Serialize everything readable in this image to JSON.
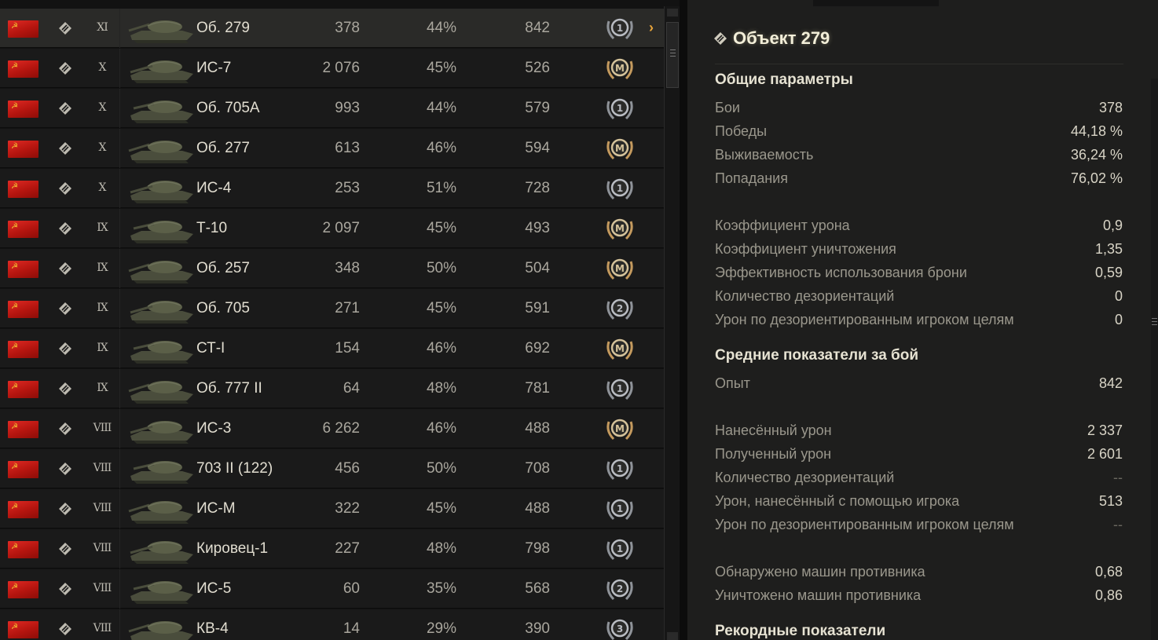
{
  "colors": {
    "accent_arrow": "#e8a43a",
    "flag_red": "#c8201a",
    "selected_row": "#2a2a28"
  },
  "vehicles": [
    {
      "tier": "XI",
      "name": "Об. 279",
      "battles": "378",
      "winrate": "44%",
      "exp": "842",
      "mastery": "1",
      "selected": true
    },
    {
      "tier": "X",
      "name": "ИС-7",
      "battles": "2 076",
      "winrate": "45%",
      "exp": "526",
      "mastery": "M"
    },
    {
      "tier": "X",
      "name": "Об. 705А",
      "battles": "993",
      "winrate": "44%",
      "exp": "579",
      "mastery": "1"
    },
    {
      "tier": "X",
      "name": "Об. 277",
      "battles": "613",
      "winrate": "46%",
      "exp": "594",
      "mastery": "M"
    },
    {
      "tier": "X",
      "name": "ИС-4",
      "battles": "253",
      "winrate": "51%",
      "exp": "728",
      "mastery": "1"
    },
    {
      "tier": "IX",
      "name": "Т-10",
      "battles": "2 097",
      "winrate": "45%",
      "exp": "493",
      "mastery": "M"
    },
    {
      "tier": "IX",
      "name": "Об. 257",
      "battles": "348",
      "winrate": "50%",
      "exp": "504",
      "mastery": "M"
    },
    {
      "tier": "IX",
      "name": "Об. 705",
      "battles": "271",
      "winrate": "45%",
      "exp": "591",
      "mastery": "2"
    },
    {
      "tier": "IX",
      "name": "СТ-I",
      "battles": "154",
      "winrate": "46%",
      "exp": "692",
      "mastery": "M"
    },
    {
      "tier": "IX",
      "name": "Об. 777 II",
      "battles": "64",
      "winrate": "48%",
      "exp": "781",
      "mastery": "1"
    },
    {
      "tier": "VIII",
      "name": "ИС-3",
      "battles": "6 262",
      "winrate": "46%",
      "exp": "488",
      "mastery": "M"
    },
    {
      "tier": "VIII",
      "name": "703 II (122)",
      "battles": "456",
      "winrate": "50%",
      "exp": "708",
      "mastery": "1"
    },
    {
      "tier": "VIII",
      "name": "ИС-М",
      "battles": "322",
      "winrate": "45%",
      "exp": "488",
      "mastery": "1"
    },
    {
      "tier": "VIII",
      "name": "Кировец-1",
      "battles": "227",
      "winrate": "48%",
      "exp": "798",
      "mastery": "1"
    },
    {
      "tier": "VIII",
      "name": "ИС-5",
      "battles": "60",
      "winrate": "35%",
      "exp": "568",
      "mastery": "2"
    },
    {
      "tier": "VIII",
      "name": "КВ-4",
      "battles": "14",
      "winrate": "29%",
      "exp": "390",
      "mastery": "3"
    }
  ],
  "detail": {
    "title": "Объект 279",
    "sections": [
      {
        "heading": "Общие параметры",
        "rows": [
          {
            "label": "Бои",
            "value": "378"
          },
          {
            "label": "Победы",
            "value": "44,18 %"
          },
          {
            "label": "Выживаемость",
            "value": "36,24 %"
          },
          {
            "label": "Попадания",
            "value": "76,02 %"
          },
          {
            "label": "",
            "value": ""
          },
          {
            "label": "Коэффициент урона",
            "value": "0,9"
          },
          {
            "label": "Коэффициент уничтожения",
            "value": "1,35"
          },
          {
            "label": "Эффективность использования брони",
            "value": "0,59"
          },
          {
            "label": "Количество дезориентаций",
            "value": "0"
          },
          {
            "label": "Урон по дезориентированным игроком целям",
            "value": "0"
          }
        ]
      },
      {
        "heading": "Средние показатели за бой",
        "rows": [
          {
            "label": "Опыт",
            "value": "842"
          },
          {
            "label": "",
            "value": ""
          },
          {
            "label": "Нанесённый урон",
            "value": "2 337"
          },
          {
            "label": "Полученный урон",
            "value": "2 601"
          },
          {
            "label": "Количество дезориентаций",
            "value": "--"
          },
          {
            "label": "Урон, нанесённый с помощью игрока",
            "value": "513"
          },
          {
            "label": "Урон по дезориентированным игроком целям",
            "value": "--"
          },
          {
            "label": "",
            "value": ""
          },
          {
            "label": "Обнаружено машин противника",
            "value": "0,68"
          },
          {
            "label": "Уничтожено машин противника",
            "value": "0,86"
          }
        ]
      },
      {
        "heading": "Рекордные показатели",
        "rows": []
      }
    ]
  }
}
